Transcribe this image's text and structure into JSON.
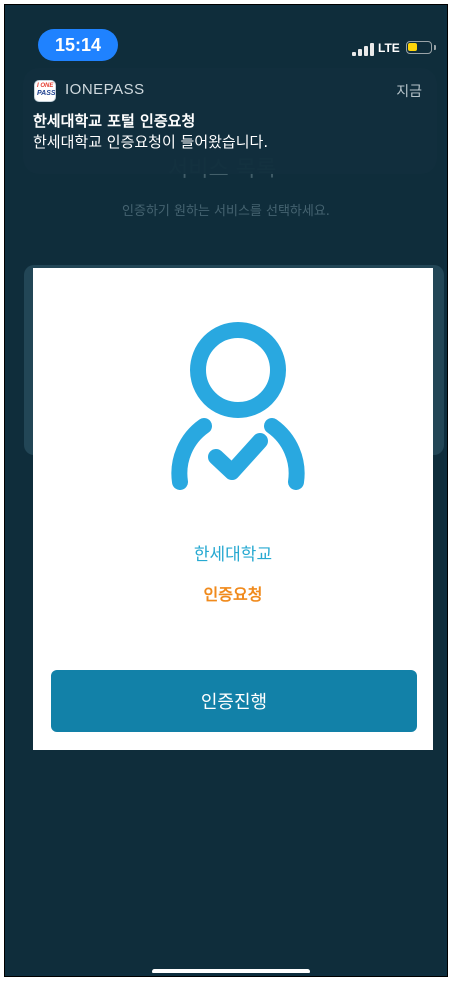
{
  "status_bar": {
    "time": "15:14",
    "network": "LTE"
  },
  "notification": {
    "app_icon_line1": "I ONE",
    "app_icon_line2": "PASS",
    "app_name": "IONEPASS",
    "time": "지금",
    "title": "한세대학교 포털 인증요청",
    "body": "한세대학교 인증요청이 들어왔습니다."
  },
  "background_page": {
    "title": "서비스 목록",
    "subtitle": "인증하기 원하는 서비스를 선택하세요."
  },
  "modal": {
    "icon": "user-check-icon",
    "school": "한세대학교",
    "request": "인증요청",
    "proceed_label": "인증진행",
    "colors": {
      "school": "#27a9d1",
      "request": "#f08a1c",
      "button": "#1281a8",
      "icon": "#29a8e0"
    }
  }
}
